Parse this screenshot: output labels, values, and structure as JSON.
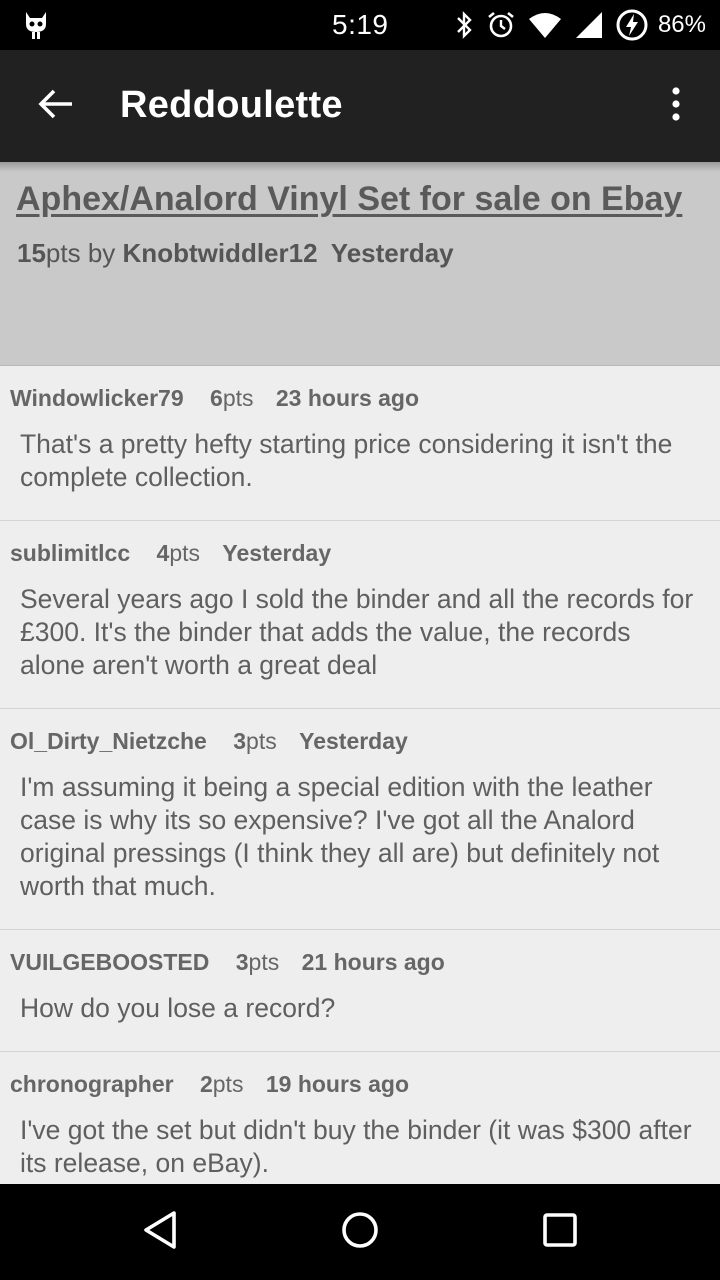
{
  "status": {
    "time": "5:19",
    "battery": "86%",
    "icons": [
      "android-icon",
      "bluetooth-icon",
      "alarm-icon",
      "wifi-icon",
      "signal-icon",
      "battery-charging-icon"
    ]
  },
  "app_bar": {
    "title": "Reddoulette",
    "back_icon": "arrow-left-icon",
    "menu_icon": "more-vert-icon"
  },
  "post": {
    "title": "Aphex/Analord Vinyl Set for sale on Ebay",
    "points": "15",
    "points_suffix": "pts by",
    "author": "Knobtwiddler12",
    "time": "Yesterday"
  },
  "comments": [
    {
      "author": "Windowlicker79",
      "points": "6",
      "pts_label": "pts",
      "time": "23 hours ago",
      "body": "That's a pretty hefty starting price considering it isn't the complete collection."
    },
    {
      "author": "sublimitlcc",
      "points": "4",
      "pts_label": "pts",
      "time": "Yesterday",
      "body": "Several years ago I sold the binder and all the records for £300. It's the binder that adds the value, the records alone aren't worth a great deal"
    },
    {
      "author": "Ol_Dirty_Nietzche",
      "points": "3",
      "pts_label": "pts",
      "time": "Yesterday",
      "body": "I'm assuming it being a special edition with the leather case is why its so expensive? I've got all the Analord original pressings (I think they all are) but definitely not worth that much."
    },
    {
      "author": "VUILGEBOOSTED",
      "points": "3",
      "pts_label": "pts",
      "time": "21 hours ago",
      "body": "How do you lose a record?"
    },
    {
      "author": "chronographer",
      "points": "2",
      "pts_label": "pts",
      "time": "19 hours ago",
      "body": "I've got the set but didn't buy the binder (it was $300 after its release, on eBay)."
    }
  ],
  "nav": {
    "icons": [
      "back-triangle-icon",
      "home-circle-icon",
      "recents-square-icon"
    ]
  }
}
